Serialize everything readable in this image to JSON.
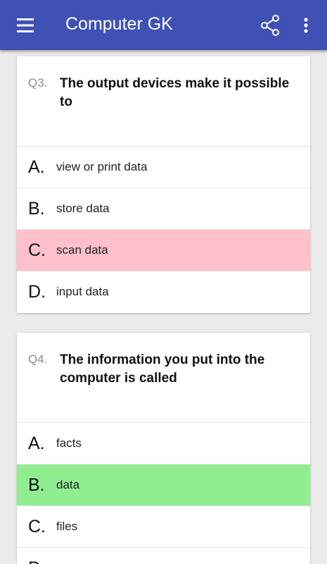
{
  "app": {
    "title": "Computer GK"
  },
  "icons": {
    "menu": "hamburger-menu-icon",
    "share": "share-icon",
    "more": "more-vert-icon"
  },
  "colors": {
    "appbar": "#3f51b5",
    "wrong": "#ffc0cb",
    "correct": "#90ee90"
  },
  "questions": [
    {
      "number": "Q3.",
      "text": "The output devices make it possible to",
      "options": [
        {
          "letter": "A.",
          "text": "view or print data",
          "state": "none"
        },
        {
          "letter": "B.",
          "text": "store data",
          "state": "none"
        },
        {
          "letter": "C.",
          "text": "scan data",
          "state": "wrong"
        },
        {
          "letter": "D.",
          "text": "input data",
          "state": "none"
        }
      ]
    },
    {
      "number": "Q4.",
      "text": "The information you put into the computer is called",
      "options": [
        {
          "letter": "A.",
          "text": "facts",
          "state": "none"
        },
        {
          "letter": "B.",
          "text": "data",
          "state": "correct"
        },
        {
          "letter": "C.",
          "text": "files",
          "state": "none"
        },
        {
          "letter": "D.",
          "text": "",
          "state": "none"
        }
      ]
    }
  ]
}
